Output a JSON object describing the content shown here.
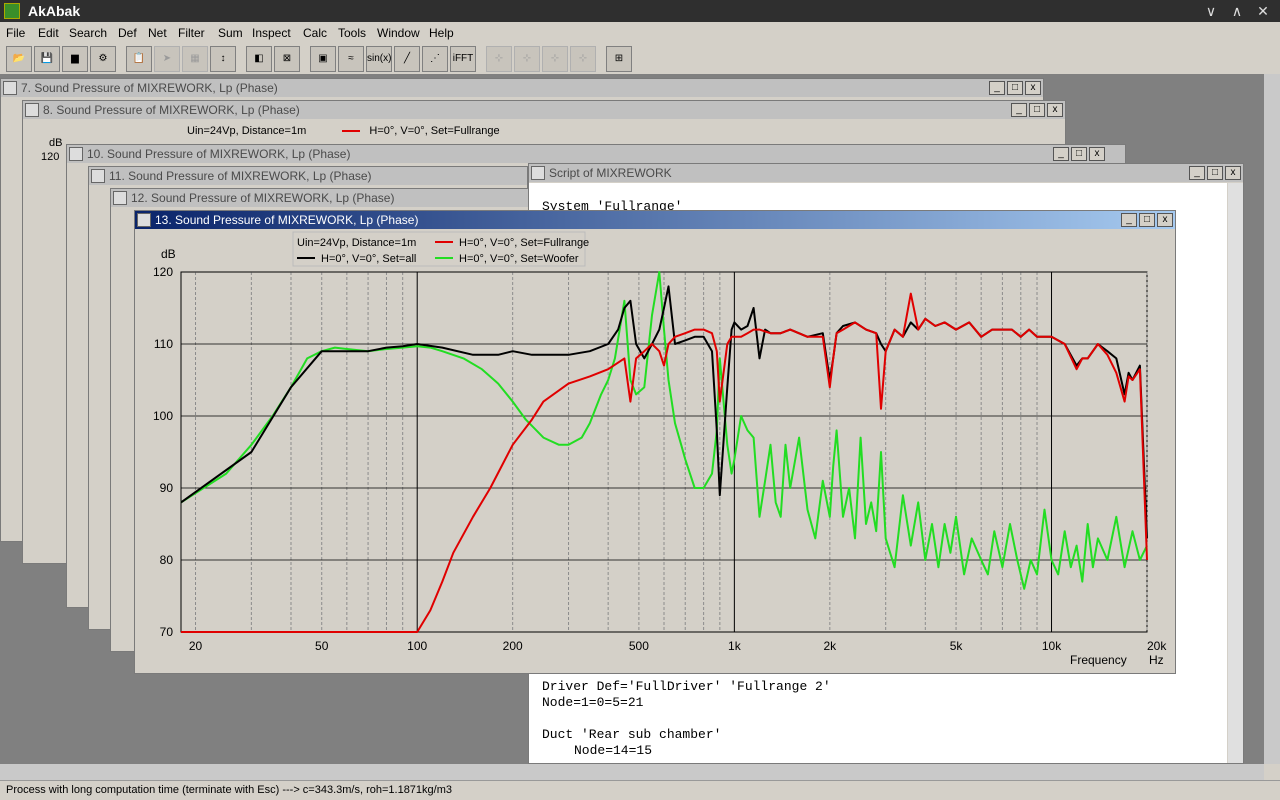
{
  "app": {
    "title": "AkAbak",
    "minimize": "∨",
    "restore": "∧",
    "close": "✕"
  },
  "menu": [
    "File",
    "Edit",
    "Search",
    "Def",
    "Net",
    "Filter",
    "Sum",
    "Inspect",
    "Calc",
    "Tools",
    "Window",
    "Help"
  ],
  "toolbar_extra_labels": {
    "sin": "sin(x)",
    "ifft": "iFFT"
  },
  "windows": {
    "w7": "7. Sound Pressure of MIXREWORK, Lp (Phase)",
    "w8": "8. Sound Pressure of MIXREWORK, Lp (Phase)",
    "w10": "10. Sound Pressure of MIXREWORK, Lp (Phase)",
    "w11": "11. Sound Pressure of MIXREWORK, Lp (Phase)",
    "w12": "12. Sound Pressure of MIXREWORK, Lp (Phase)",
    "w13": "13. Sound Pressure of MIXREWORK, Lp (Phase)",
    "script": "Script of MIXREWORK"
  },
  "w8_legend": {
    "info": "Uin=24Vp, Distance=1m",
    "series": "H=0°, V=0°, Set=Fullrange"
  },
  "w8_axis": {
    "unit": "dB",
    "top": "120"
  },
  "script_text": {
    "l1": "System 'Fullrange'",
    "l2": "Driver Def='FullDriver' 'Fullrange 2'",
    "l3": "Node=1=0=5=21",
    "l4": "Duct 'Rear sub chamber'",
    "l5": "Node=14=15"
  },
  "status": "Process with long computation time (terminate with Esc) ---> c=343.3m/s, roh=1.1871kg/m3",
  "chart_data": {
    "type": "line",
    "title": "",
    "info": "Uin=24Vp, Distance=1m",
    "ylabel": "dB",
    "xlabel": "Frequency",
    "xunit": "Hz",
    "xscale": "log",
    "xlim": [
      18,
      20000
    ],
    "ylim": [
      70,
      120
    ],
    "yticks": [
      70,
      80,
      90,
      100,
      110,
      120
    ],
    "ytick_labels": [
      "70",
      "80",
      "90",
      "100",
      "110",
      "120"
    ],
    "xticks": [
      20,
      50,
      100,
      200,
      500,
      1000,
      2000,
      5000,
      10000,
      20000
    ],
    "xtick_labels": [
      "20",
      "50",
      "100",
      "200",
      "500",
      "1k",
      "2k",
      "5k",
      "10k",
      "20k"
    ],
    "grid": true,
    "legend_position": "top",
    "series": [
      {
        "name": "H=0°, V=0°, Set=all",
        "color": "#000000",
        "x": [
          18,
          30,
          40,
          50,
          60,
          70,
          80,
          90,
          100,
          120,
          150,
          180,
          200,
          230,
          250,
          300,
          350,
          400,
          430,
          450,
          470,
          490,
          520,
          550,
          580,
          600,
          620,
          650,
          700,
          750,
          800,
          850,
          880,
          900,
          950,
          980,
          1000,
          1050,
          1100,
          1150,
          1200,
          1250,
          1300,
          1400,
          1500,
          1700,
          1900,
          2000,
          2050,
          2100,
          2200,
          2400,
          2600,
          2800,
          2900,
          3000,
          3200,
          3400,
          3600,
          3800,
          4000,
          4300,
          4600,
          5000,
          5500,
          6000,
          6500,
          7000,
          7500,
          8000,
          8500,
          9000,
          9500,
          10000,
          11000,
          12000,
          12500,
          13000,
          14000,
          15000,
          16000,
          17000,
          17500,
          18000,
          19000,
          20000
        ],
        "y": [
          88,
          95,
          104,
          109,
          109,
          109,
          109.5,
          109.7,
          110,
          109.5,
          108.5,
          108.5,
          109,
          108.5,
          108.5,
          108.5,
          109,
          110,
          112,
          115,
          116,
          110,
          108,
          110,
          112,
          115,
          118,
          110,
          110.5,
          111,
          111,
          109,
          98,
          89,
          104,
          112,
          113,
          112,
          112.5,
          115,
          108,
          112,
          111.5,
          111.5,
          112,
          111,
          111.5,
          105,
          108,
          111.5,
          112.5,
          113,
          112,
          111.5,
          110,
          109,
          112,
          111,
          113,
          112,
          113.5,
          112.5,
          113,
          112,
          113,
          111,
          112,
          112,
          112,
          111,
          112,
          111,
          111,
          111,
          110,
          107,
          108,
          108,
          110,
          109,
          108,
          103,
          106,
          105,
          107,
          83
        ]
      },
      {
        "name": "H=0°, V=0°, Set=Fullrange",
        "color": "#e00000",
        "x": [
          18,
          30,
          40,
          50,
          60,
          70,
          80,
          90,
          100,
          110,
          120,
          130,
          150,
          170,
          200,
          230,
          250,
          300,
          350,
          400,
          450,
          470,
          490,
          520,
          550,
          580,
          600,
          620,
          650,
          700,
          750,
          800,
          850,
          880,
          900,
          950,
          980,
          1000,
          1050,
          1100,
          1150,
          1200,
          1300,
          1400,
          1500,
          1700,
          1900,
          2000,
          2050,
          2100,
          2200,
          2400,
          2600,
          2800,
          2900,
          3000,
          3200,
          3400,
          3600,
          3800,
          4000,
          4300,
          4600,
          5000,
          5500,
          6000,
          6500,
          7000,
          7500,
          8000,
          8500,
          9000,
          9500,
          10000,
          11000,
          12000,
          12500,
          13000,
          14000,
          15000,
          16000,
          17000,
          17500,
          18000,
          19000,
          20000
        ],
        "y": [
          70,
          70,
          70,
          70,
          70,
          70,
          70,
          70,
          70,
          73,
          77,
          81,
          86,
          90,
          96,
          99.5,
          102,
          104.5,
          105.5,
          106.5,
          108,
          102,
          108,
          109,
          110,
          109,
          107,
          110,
          111,
          111.5,
          112,
          112,
          111.5,
          109,
          102,
          110,
          111,
          111,
          111,
          111.5,
          112,
          112,
          111.5,
          111.5,
          112,
          111,
          111,
          104,
          108,
          111.5,
          112,
          113,
          112,
          111.5,
          101,
          109,
          112,
          111,
          117,
          112,
          113.5,
          112.5,
          113,
          112,
          113,
          111,
          112,
          112,
          112,
          111,
          112,
          111,
          111,
          111,
          110,
          106.5,
          108,
          108,
          110,
          108.5,
          106,
          102,
          105.5,
          105,
          106.5,
          80
        ]
      },
      {
        "name": "H=0°, V=0°, Set=Woofer",
        "color": "#22dd22",
        "x": [
          18,
          25,
          30,
          35,
          40,
          45,
          50,
          55,
          60,
          70,
          80,
          90,
          100,
          110,
          120,
          140,
          160,
          180,
          200,
          220,
          250,
          280,
          300,
          330,
          350,
          380,
          400,
          420,
          450,
          470,
          490,
          520,
          550,
          580,
          600,
          620,
          650,
          680,
          700,
          750,
          800,
          850,
          880,
          900,
          950,
          980,
          1000,
          1050,
          1100,
          1150,
          1200,
          1250,
          1300,
          1350,
          1400,
          1450,
          1500,
          1600,
          1700,
          1800,
          1900,
          2000,
          2050,
          2100,
          2200,
          2300,
          2400,
          2500,
          2600,
          2700,
          2800,
          2900,
          3000,
          3200,
          3400,
          3600,
          3800,
          4000,
          4200,
          4400,
          4600,
          4800,
          5000,
          5300,
          5600,
          6000,
          6300,
          6600,
          7000,
          7400,
          7800,
          8200,
          8600,
          9000,
          9500,
          10000,
          10500,
          11000,
          11500,
          12000,
          12500,
          13000,
          13500,
          14000,
          15000,
          16000,
          17000,
          18000,
          19000,
          20000
        ],
        "y": [
          88,
          92,
          96,
          100,
          104,
          108,
          109,
          109.5,
          109.3,
          109,
          109.3,
          109.5,
          109.7,
          109.5,
          109,
          108,
          106.5,
          104.5,
          102,
          99.5,
          97,
          96,
          96,
          97,
          99,
          103,
          105,
          108,
          116,
          105,
          103,
          104,
          114,
          120,
          112,
          105,
          99,
          96,
          94,
          90,
          90,
          92,
          98,
          108,
          96,
          92,
          94,
          100,
          98,
          97,
          86,
          91,
          96,
          88,
          86,
          96,
          90,
          97,
          87,
          83,
          91,
          86,
          93,
          98,
          86,
          90,
          83,
          97,
          85,
          88,
          84,
          95,
          83,
          79,
          89,
          82,
          88,
          80,
          85,
          79,
          85,
          81,
          86,
          78,
          83,
          80,
          78,
          84,
          79,
          85,
          80,
          76,
          80,
          78,
          87,
          80,
          78,
          84,
          79,
          82,
          77,
          85,
          79,
          83,
          80,
          86,
          79,
          84,
          80,
          82
        ]
      }
    ]
  }
}
